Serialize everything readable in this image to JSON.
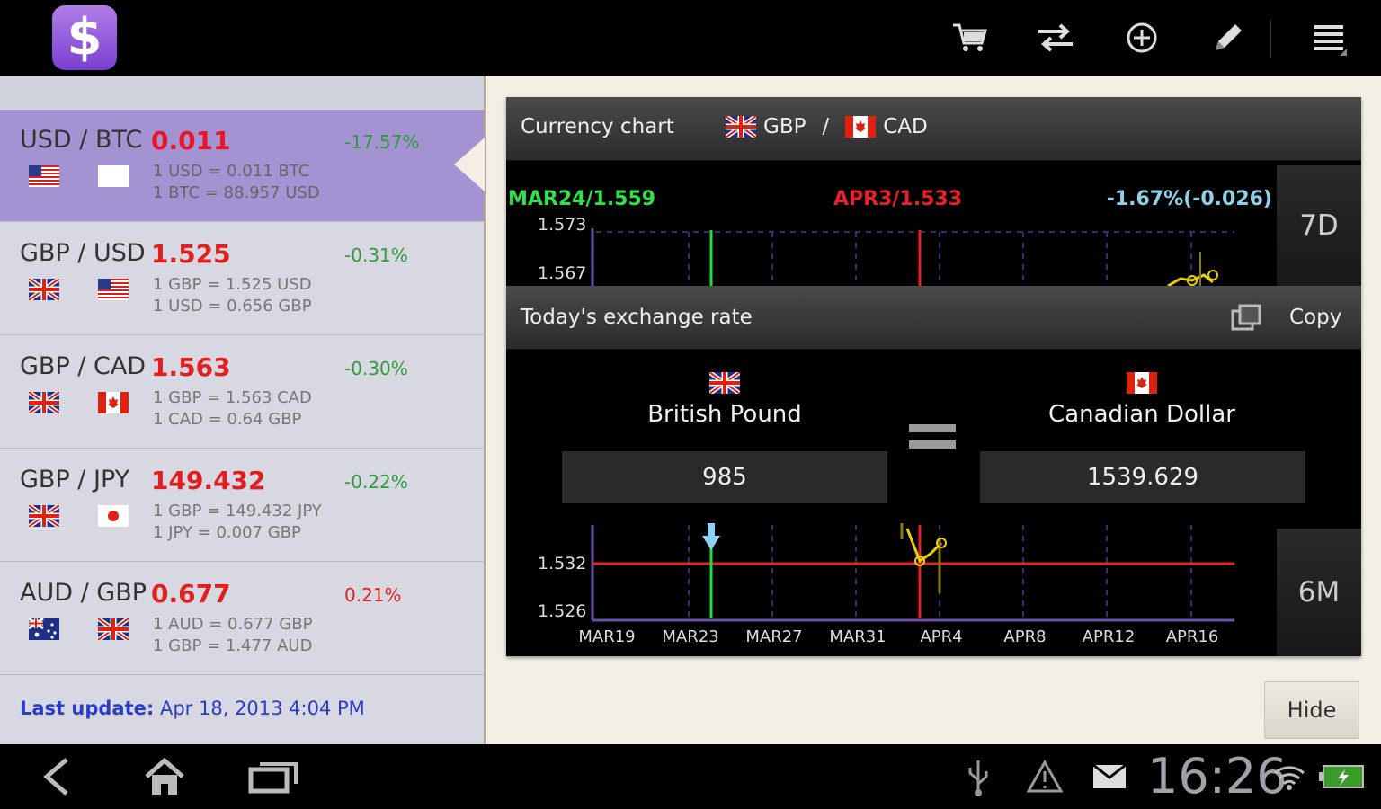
{
  "topbar": {
    "logo_glyph": "$",
    "icons": [
      "cart-icon",
      "swap-icon",
      "add-icon",
      "edit-icon",
      "menu-icon"
    ]
  },
  "pairs": [
    {
      "name": "USD / BTC",
      "rate": "0.011",
      "change": "-17.57%",
      "change_color": "#2f9a3c",
      "line1": "1 USD = 0.011 BTC",
      "line2": "1 BTC = 88.957 USD",
      "flag_a": "us",
      "flag_b": "btc",
      "selected": true
    },
    {
      "name": "GBP / USD",
      "rate": "1.525",
      "change": "-0.31%",
      "change_color": "#2f9a3c",
      "line1": "1 GBP = 1.525 USD",
      "line2": "1 USD = 0.656 GBP",
      "flag_a": "uk",
      "flag_b": "us"
    },
    {
      "name": "GBP / CAD",
      "rate": "1.563",
      "change": "-0.30%",
      "change_color": "#2f9a3c",
      "line1": "1 GBP = 1.563 CAD",
      "line2": "1 CAD = 0.64 GBP",
      "flag_a": "uk",
      "flag_b": "ca"
    },
    {
      "name": "GBP / JPY",
      "rate": "149.432",
      "change": "-0.22%",
      "change_color": "#2f9a3c",
      "line1": "1 GBP = 149.432 JPY",
      "line2": "1 JPY = 0.007 GBP",
      "flag_a": "uk",
      "flag_b": "jp"
    },
    {
      "name": "AUD / GBP",
      "rate": "0.677",
      "change": "0.21%",
      "change_color": "#e02020",
      "line1": "1 AUD = 0.677 GBP",
      "line2": "1 GBP = 1.477 AUD",
      "flag_a": "au",
      "flag_b": "uk"
    }
  ],
  "last_update": {
    "label": "Last update:",
    "value": "Apr 18, 2013 4:04 PM"
  },
  "currency_chart": {
    "title": "Currency chart",
    "base": "GBP",
    "separator": "/",
    "quote": "CAD",
    "range_button": "7D",
    "left_marker": "MAR24/1.559",
    "right_marker": "APR3/1.533",
    "change": "-1.67%(-0.026)",
    "y_ticks": [
      "1.573",
      "1.567"
    ]
  },
  "exchange": {
    "title": "Today's exchange rate",
    "copy_label": "Copy",
    "from_name": "British Pound",
    "to_name": "Canadian Dollar",
    "from_amount": "985",
    "to_amount": "1539.629",
    "range_button": "6M",
    "y_ticks": [
      "1.532",
      "1.526"
    ],
    "x_ticks": [
      "MAR19",
      "MAR23",
      "MAR27",
      "MAR31",
      "APR4",
      "APR8",
      "APR12",
      "APR16"
    ]
  },
  "hide_label": "Hide",
  "system": {
    "clock": "16:26"
  }
}
